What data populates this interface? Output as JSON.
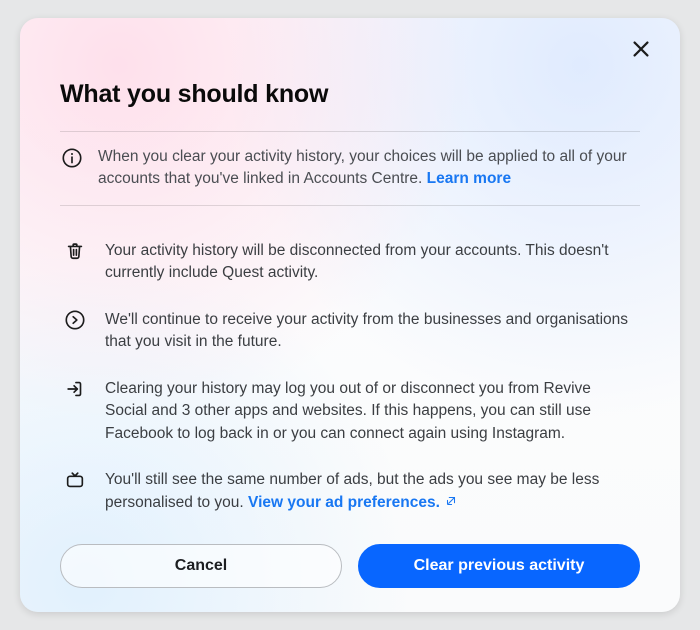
{
  "title": "What you should know",
  "close_label": "Close",
  "banner": {
    "text": "When you clear your activity history, your choices will be applied to all of your accounts that you've linked in Accounts Centre.",
    "link": "Learn more"
  },
  "items": [
    {
      "text": "Your activity history will be disconnected from your accounts. This doesn't currently include Quest activity."
    },
    {
      "text": "We'll continue to receive your activity from the businesses and organisations that you visit in the future."
    },
    {
      "text": "Clearing your history may log you out of or disconnect you from Revive Social and 3 other apps and websites. If this happens, you can still use Facebook to log back in or you can connect again using Instagram."
    },
    {
      "text": "You'll still see the same number of ads, but the ads you see may be less personalised to you.",
      "link": "View your ad preferences."
    }
  ],
  "buttons": {
    "cancel": "Cancel",
    "confirm": "Clear previous activity"
  },
  "colors": {
    "primary": "#0866ff",
    "link": "#1877f2"
  }
}
